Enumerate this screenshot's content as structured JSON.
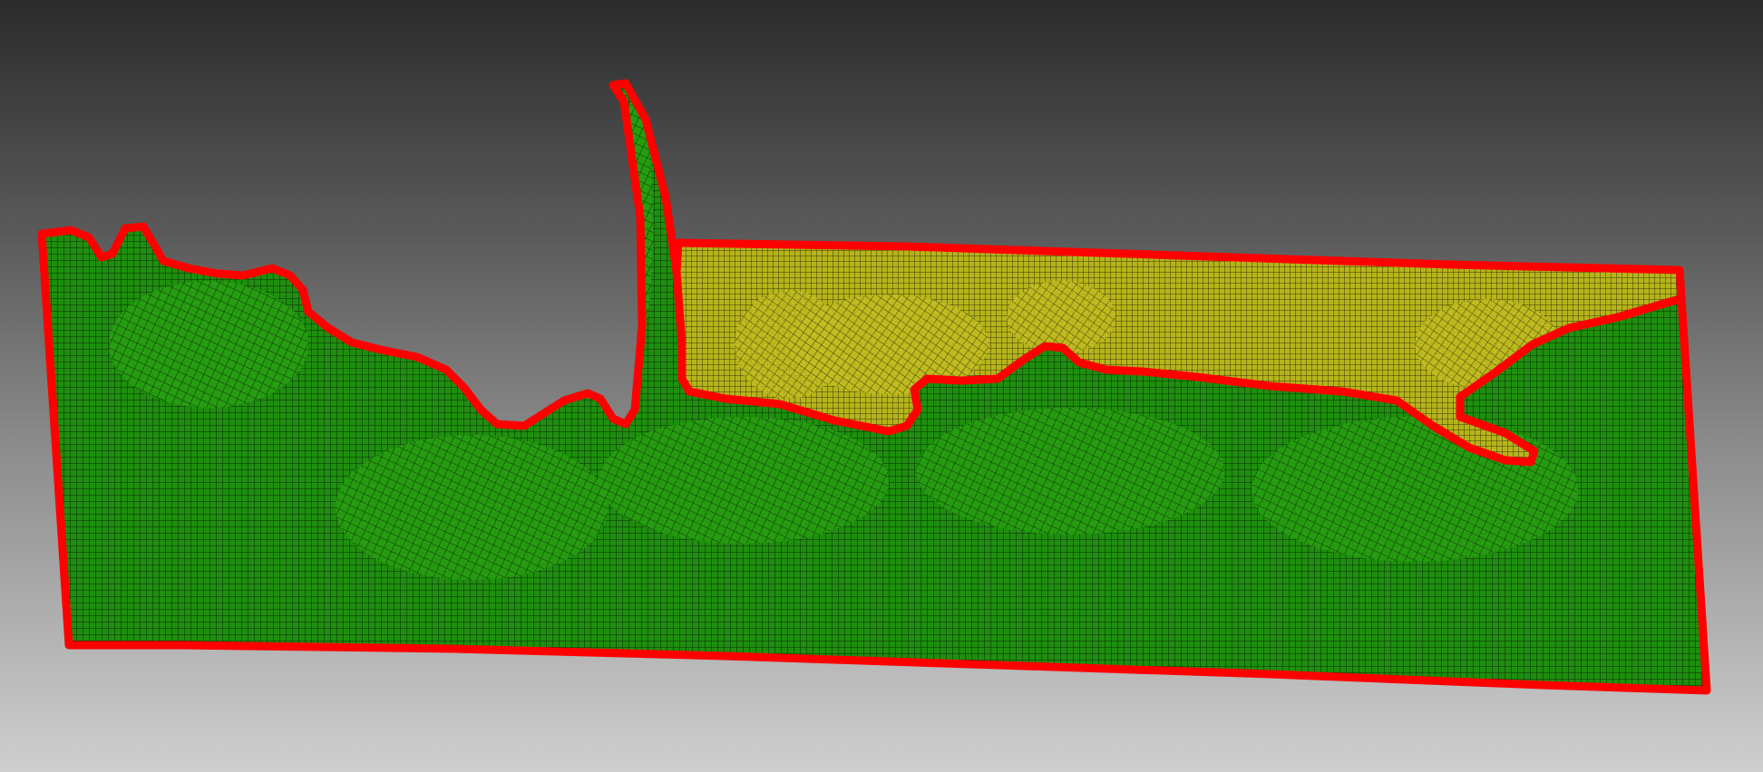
{
  "viewport": {
    "background": "gradient-dark-to-light-gray"
  },
  "colors": {
    "green_region": "#1e8f0e",
    "green_mesh_line": "#0a2a05",
    "yellow_region": "#b7b41a",
    "yellow_mesh_line": "#3a3a08",
    "boundary": "#ff0000"
  },
  "regions": [
    {
      "name": "green-mesh-region",
      "color_key": "green_region"
    },
    {
      "name": "yellow-mesh-region",
      "color_key": "yellow_region"
    }
  ]
}
